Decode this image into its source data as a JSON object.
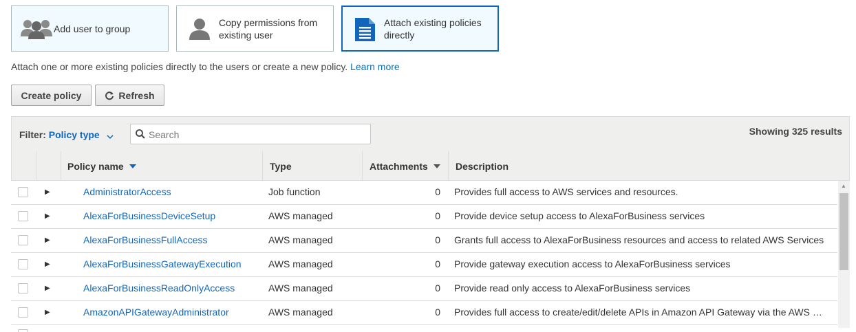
{
  "options": [
    {
      "label": "Add user to group",
      "icon": "group-icon",
      "selected": false
    },
    {
      "label": "Copy permissions from existing user",
      "icon": "user-icon",
      "selected": false
    },
    {
      "label": "Attach existing policies directly",
      "icon": "document-icon",
      "selected": true
    }
  ],
  "intro": {
    "text": "Attach one or more existing policies directly to the users or create a new policy.",
    "link": "Learn more"
  },
  "toolbar": {
    "create_label": "Create policy",
    "refresh_label": "Refresh"
  },
  "filter": {
    "label": "Filter:",
    "value": "Policy type",
    "search_placeholder": "Search",
    "results": "Showing 325 results"
  },
  "columns": {
    "name": "Policy name",
    "type": "Type",
    "attachments": "Attachments",
    "description": "Description"
  },
  "rows": [
    {
      "name": "AdministratorAccess",
      "type": "Job function",
      "attachments": "0",
      "description": "Provides full access to AWS services and resources."
    },
    {
      "name": "AlexaForBusinessDeviceSetup",
      "type": "AWS managed",
      "attachments": "0",
      "description": "Provide device setup access to AlexaForBusiness services"
    },
    {
      "name": "AlexaForBusinessFullAccess",
      "type": "AWS managed",
      "attachments": "0",
      "description": "Grants full access to AlexaForBusiness resources and access to related AWS Services"
    },
    {
      "name": "AlexaForBusinessGatewayExecution",
      "type": "AWS managed",
      "attachments": "0",
      "description": "Provide gateway execution access to AlexaForBusiness services"
    },
    {
      "name": "AlexaForBusinessReadOnlyAccess",
      "type": "AWS managed",
      "attachments": "0",
      "description": "Provide read only access to AlexaForBusiness services"
    },
    {
      "name": "AmazonAPIGatewayAdministrator",
      "type": "AWS managed",
      "attachments": "0",
      "description": "Provides full access to create/edit/delete APIs in Amazon API Gateway via the AWS Management Console."
    }
  ],
  "colors": {
    "accent": "#1166bb",
    "link": "#0073bb",
    "selected_bg": "#f1faff",
    "header_bg": "#efefee"
  }
}
